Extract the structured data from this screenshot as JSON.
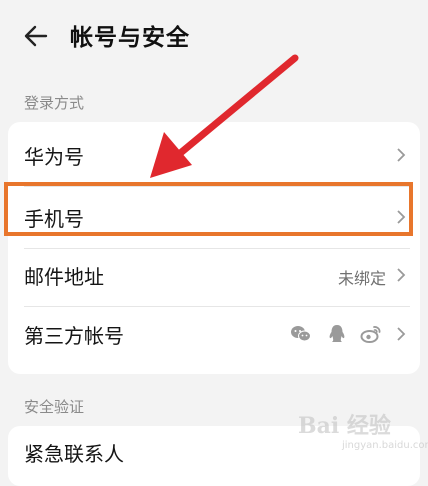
{
  "header": {
    "back_icon": "arrow-left-icon",
    "title": "帐号与安全"
  },
  "sections": {
    "login": {
      "label": "登录方式",
      "rows": {
        "huawei_id": {
          "label": "华为号"
        },
        "phone": {
          "label": "手机号",
          "value": ""
        },
        "email": {
          "label": "邮件地址",
          "value": "未绑定"
        },
        "third_party": {
          "label": "第三方帐号",
          "icons": [
            "wechat-icon",
            "qq-icon",
            "weibo-icon"
          ]
        }
      }
    },
    "security": {
      "label": "安全验证",
      "rows": {
        "emergency": {
          "label": "紧急联系人"
        }
      }
    }
  },
  "watermark": {
    "text": "Bai 经验",
    "sub": "jingyan.baidu.com"
  },
  "colors": {
    "highlight": "#e8762c",
    "arrow": "#e0282e",
    "background": "#f3f3f3",
    "card": "#ffffff"
  }
}
